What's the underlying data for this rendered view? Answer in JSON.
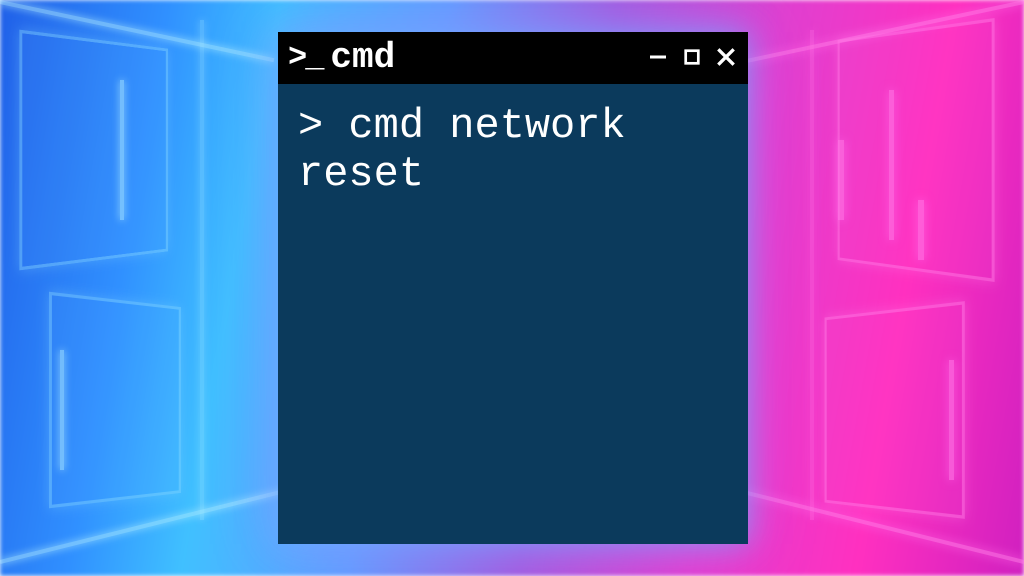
{
  "window": {
    "title": "cmd",
    "icon_prompt": ">_"
  },
  "terminal": {
    "prompt": "> ",
    "command": "cmd network reset"
  },
  "colors": {
    "terminal_bg": "#0b3a5c",
    "titlebar_bg": "#000000",
    "text": "#ffffff"
  }
}
